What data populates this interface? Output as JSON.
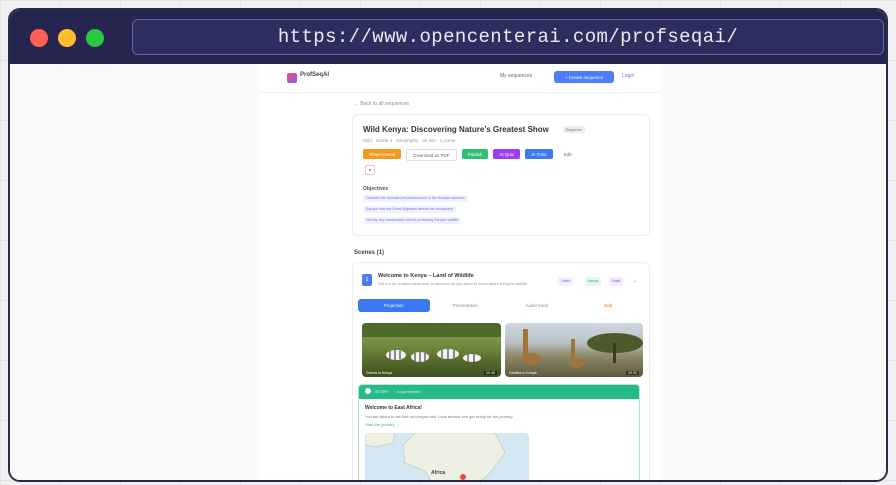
{
  "browser": {
    "url": "https://www.opencenterai.com/profseqai/",
    "controls": [
      "close",
      "minimize",
      "maximize"
    ]
  },
  "site": {
    "logo_text": "ProfSeqAI",
    "nav_link": "My sequences",
    "nav_button": "+ Create sequence",
    "nav_login": "Login"
  },
  "back_link": "← Back to all sequences",
  "lesson": {
    "title": "Wild Kenya: Discovering Nature’s Greatest Show",
    "level_badge": "Beginner",
    "meta": "Wild · Grade 4 · Geography · 30 min · 1 scene",
    "buttons": [
      "Share lesson",
      "Download as PDF",
      "Publish",
      "AI Quiz",
      "AI Tutor",
      "Edit"
    ],
    "objectives_title": "Objectives",
    "objectives": [
      "Describe the animals and plants found in the Kenyan savanna",
      "Explain how the Great Migration affects the ecosystem",
      "Identify key conservation efforts protecting Kenyan wildlife"
    ]
  },
  "scenes": {
    "header": "Scenes (1)",
    "items": [
      {
        "number": "1",
        "title": "Welcome to Kenya – Land of Wildlife",
        "subtitle": "Set out for a safari adventure to discover all you need to know about Kenya’s wildlife",
        "tags": [
          "Safari",
          "Kenya",
          "Draft"
        ],
        "tabs": [
          "Projection",
          "Presentation",
          "Audio track",
          "Edit"
        ],
        "photos": [
          {
            "caption": "Zebras in Kenya",
            "duration": "00:45"
          },
          {
            "caption": "Giraffes in Kenya",
            "duration": "00:30"
          }
        ],
        "story": {
          "header": "STORY",
          "header_note": "AI-generated",
          "title": "Welcome to East Africa!",
          "text": "You are about to set foot on Kenyan soil. Look around and get ready for the journey.",
          "link": "Start the journey →",
          "map_label": "Africa"
        }
      }
    ]
  }
}
